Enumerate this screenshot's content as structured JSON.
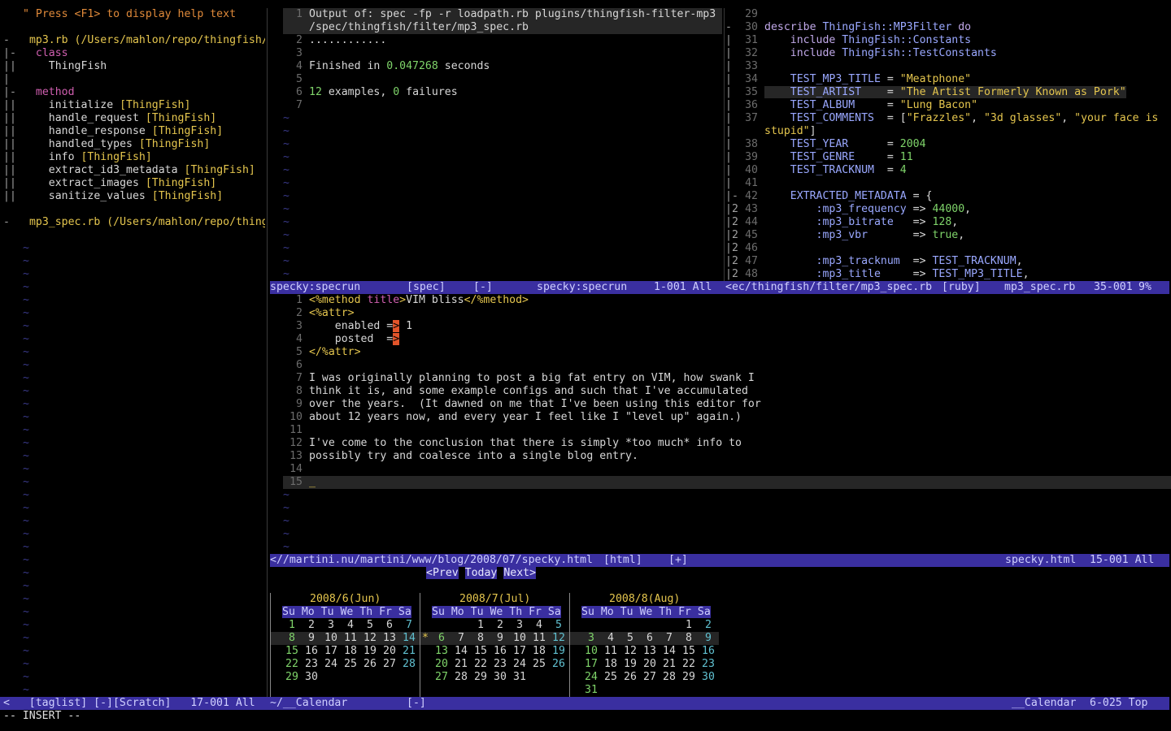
{
  "taglist": {
    "help": "\" Press <F1> to display help text",
    "lines": [
      {
        "fold": "",
        "text": ""
      },
      {
        "fold": "-",
        "text": " mp3.rb (/Users/mahlon/repo/thingfish/",
        "cls": "c-yel"
      },
      {
        "fold": "|-",
        "text": "  class",
        "cls": "c-mag"
      },
      {
        "fold": "||",
        "text": "    ThingFish",
        "cls": ""
      },
      {
        "fold": "|",
        "text": "",
        "cls": ""
      },
      {
        "fold": "|-",
        "text": "  method",
        "cls": "c-mag"
      },
      {
        "fold": "||",
        "text": "    initialize ",
        "cls": "",
        "tag": "[ThingFish]"
      },
      {
        "fold": "||",
        "text": "    handle_request ",
        "cls": "",
        "tag": "[ThingFish]"
      },
      {
        "fold": "||",
        "text": "    handle_response ",
        "cls": "",
        "tag": "[ThingFish]"
      },
      {
        "fold": "||",
        "text": "    handled_types ",
        "cls": "",
        "tag": "[ThingFish]"
      },
      {
        "fold": "||",
        "text": "    info ",
        "cls": "",
        "tag": "[ThingFish]"
      },
      {
        "fold": "||",
        "text": "    extract_id3_metadata ",
        "cls": "",
        "tag": "[ThingFish]"
      },
      {
        "fold": "||",
        "text": "    extract_images ",
        "cls": "",
        "tag": "[ThingFish]"
      },
      {
        "fold": "||",
        "text": "    sanitize_values ",
        "cls": "",
        "tag": "[ThingFish]"
      },
      {
        "fold": "",
        "text": "",
        "cls": ""
      },
      {
        "fold": "-",
        "text": " mp3_spec.rb (/Users/mahlon/repo/thing",
        "cls": "c-yel"
      },
      {
        "fold": "",
        "text": "",
        "cls": ""
      }
    ],
    "tilde": "~"
  },
  "specrun": {
    "lines": [
      {
        "n": "1",
        "text": "Output of: spec -fp -r loadpath.rb plugins/thingfish-filter-mp3",
        "hl": true
      },
      {
        "n": "",
        "text": "/spec/thingfish/filter/mp3_spec.rb",
        "hl": true
      },
      {
        "n": "2",
        "text": "............"
      },
      {
        "n": "3",
        "text": ""
      },
      {
        "n": "4",
        "text": "Finished in ",
        "num": "0.047268",
        "rest": " seconds"
      },
      {
        "n": "5",
        "text": ""
      },
      {
        "n": "6",
        "text": "",
        "num": "12",
        "rest": " examples, ",
        "num2": "0",
        "rest2": " failures"
      },
      {
        "n": "7",
        "text": ""
      }
    ],
    "status": {
      "left": "specky:specrun",
      "ft": "[spec]",
      "mod": "[-]",
      "name": "specky:specrun",
      "pos": "1-001 All"
    }
  },
  "spec_file": {
    "status": {
      "left": "<ec/thingfish/filter/mp3_spec.rb",
      "ft": "[ruby]",
      "name": "mp3_spec.rb",
      "pos": "35-001",
      "pct": "9%"
    },
    "lines": [
      {
        "f": "",
        "n": "29",
        "segs": []
      },
      {
        "f": "-",
        "n": "30",
        "segs": [
          [
            "c-kw",
            "describe "
          ],
          [
            "c-const",
            "ThingFish::MP3Filter "
          ],
          [
            "c-kw",
            "do"
          ]
        ]
      },
      {
        "f": "|",
        "n": "31",
        "segs": [
          [
            "",
            "    "
          ],
          [
            "c-kw",
            "include "
          ],
          [
            "c-const",
            "ThingFish::Constants"
          ]
        ]
      },
      {
        "f": "|",
        "n": "32",
        "segs": [
          [
            "",
            "    "
          ],
          [
            "c-kw",
            "include "
          ],
          [
            "c-const",
            "ThingFish::TestConstants"
          ]
        ]
      },
      {
        "f": "|",
        "n": "33",
        "segs": []
      },
      {
        "f": "|",
        "n": "34",
        "segs": [
          [
            "",
            "    "
          ],
          [
            "c-const",
            "TEST_MP3_TITLE "
          ],
          [
            "",
            "= "
          ],
          [
            "c-str",
            "\"Meatphone\""
          ]
        ]
      },
      {
        "f": "|",
        "n": "35",
        "hl": true,
        "segs": [
          [
            "",
            "    "
          ],
          [
            "c-const",
            "TEST_ARTIST    "
          ],
          [
            "",
            "= "
          ],
          [
            "c-str",
            "\"The Artist Formerly Known as Pork\""
          ]
        ]
      },
      {
        "f": "|",
        "n": "36",
        "segs": [
          [
            "",
            "    "
          ],
          [
            "c-const",
            "TEST_ALBUM     "
          ],
          [
            "",
            "= "
          ],
          [
            "c-str",
            "\"Lung Bacon\""
          ]
        ]
      },
      {
        "f": "|",
        "n": "37",
        "segs": [
          [
            "",
            "    "
          ],
          [
            "c-const",
            "TEST_COMMENTS  "
          ],
          [
            "",
            "= ["
          ],
          [
            "c-str",
            "\"Frazzles\""
          ],
          [
            "",
            ", "
          ],
          [
            "c-str",
            "\"3d glasses\""
          ],
          [
            "",
            ", "
          ],
          [
            "c-str",
            "\"your face is"
          ]
        ]
      },
      {
        "f": "|",
        "n": "",
        "segs": [
          [
            "c-str",
            "stupid\""
          ],
          [
            "",
            "]"
          ]
        ]
      },
      {
        "f": "|",
        "n": "38",
        "segs": [
          [
            "",
            "    "
          ],
          [
            "c-const",
            "TEST_YEAR      "
          ],
          [
            "",
            "= "
          ],
          [
            "c-num",
            "2004"
          ]
        ]
      },
      {
        "f": "|",
        "n": "39",
        "segs": [
          [
            "",
            "    "
          ],
          [
            "c-const",
            "TEST_GENRE     "
          ],
          [
            "",
            "= "
          ],
          [
            "c-num",
            "11"
          ]
        ]
      },
      {
        "f": "|",
        "n": "40",
        "segs": [
          [
            "",
            "    "
          ],
          [
            "c-const",
            "TEST_TRACKNUM  "
          ],
          [
            "",
            "= "
          ],
          [
            "c-num",
            "4"
          ]
        ]
      },
      {
        "f": "|",
        "n": "41",
        "segs": []
      },
      {
        "f": "|-",
        "n": "42",
        "segs": [
          [
            "",
            "    "
          ],
          [
            "c-const",
            "EXTRACTED_METADATA "
          ],
          [
            "",
            "= {"
          ]
        ]
      },
      {
        "f": "|2",
        "n": "43",
        "segs": [
          [
            "",
            "        "
          ],
          [
            "c-const",
            ":mp3_frequency "
          ],
          [
            "",
            "=> "
          ],
          [
            "c-num",
            "44000"
          ],
          [
            "",
            ","
          ]
        ]
      },
      {
        "f": "|2",
        "n": "44",
        "segs": [
          [
            "",
            "        "
          ],
          [
            "c-const",
            ":mp3_bitrate   "
          ],
          [
            "",
            "=> "
          ],
          [
            "c-num",
            "128"
          ],
          [
            "",
            ","
          ]
        ]
      },
      {
        "f": "|2",
        "n": "45",
        "segs": [
          [
            "",
            "        "
          ],
          [
            "c-const",
            ":mp3_vbr       "
          ],
          [
            "",
            "=> "
          ],
          [
            "c-num",
            "true"
          ],
          [
            "",
            ","
          ]
        ]
      },
      {
        "f": "|2",
        "n": "46",
        "segs": []
      },
      {
        "f": "|2",
        "n": "47",
        "segs": [
          [
            "",
            "        "
          ],
          [
            "c-const",
            ":mp3_tracknum  "
          ],
          [
            "",
            "=> "
          ],
          [
            "c-const",
            "TEST_TRACKNUM"
          ],
          [
            "",
            ","
          ]
        ]
      },
      {
        "f": "|2",
        "n": "48",
        "segs": [
          [
            "",
            "        "
          ],
          [
            "c-const",
            ":mp3_title     "
          ],
          [
            "",
            "=> "
          ],
          [
            "c-const",
            "TEST_MP3_TITLE"
          ],
          [
            "",
            ","
          ]
        ]
      }
    ]
  },
  "blog": {
    "lines": [
      {
        "n": "1",
        "segs": [
          [
            "c-str",
            "<%method "
          ],
          [
            "c-mag",
            "title"
          ],
          [
            "c-str",
            ">"
          ],
          [
            "",
            "VIM bliss"
          ],
          [
            "c-str",
            "</%method>"
          ]
        ]
      },
      {
        "n": "2",
        "segs": [
          [
            "c-str",
            "<%attr>"
          ]
        ]
      },
      {
        "n": "3",
        "segs": [
          [
            "",
            "    enabled ="
          ],
          [
            "cursor",
            ">"
          ],
          [
            "",
            " 1"
          ]
        ]
      },
      {
        "n": "4",
        "segs": [
          [
            "",
            "    posted  ="
          ],
          [
            "cursor",
            ">"
          ]
        ]
      },
      {
        "n": "5",
        "segs": [
          [
            "c-str",
            "</%attr>"
          ]
        ]
      },
      {
        "n": "6",
        "segs": []
      },
      {
        "n": "7",
        "segs": [
          [
            "",
            "I was originally planning to post a big fat entry on VIM, how swank I"
          ]
        ]
      },
      {
        "n": "8",
        "segs": [
          [
            "",
            "think it is, and some example configs and such that I've accumulated"
          ]
        ]
      },
      {
        "n": "9",
        "segs": [
          [
            "",
            "over the years.  (It dawned on me that I've been using this editor for"
          ]
        ]
      },
      {
        "n": "10",
        "segs": [
          [
            "",
            "about 12 years now, and every year I feel like I \"level up\" again.)"
          ]
        ]
      },
      {
        "n": "11",
        "segs": []
      },
      {
        "n": "12",
        "segs": [
          [
            "",
            "I've come to the conclusion that there is simply *too much* info to"
          ]
        ]
      },
      {
        "n": "13",
        "segs": [
          [
            "",
            "possibly try and coalesce into a single blog entry."
          ]
        ]
      },
      {
        "n": "14",
        "segs": []
      },
      {
        "n": "15",
        "hl": true,
        "segs": [
          [
            "c-yel",
            "_"
          ]
        ]
      }
    ],
    "status": {
      "left": "<//martini.nu/martini/www/blog/2008/07/specky.html",
      "ft": "[html]",
      "mod": "[+]",
      "name": "specky.html",
      "pos": "15-001 All"
    }
  },
  "calendar": {
    "nav": {
      "prev": "<Prev",
      "today": "Today",
      "next": "Next>"
    },
    "months": [
      {
        "title": "2008/6(Jun)",
        "rows": [
          [
            "1",
            "2",
            "3",
            "4",
            "5",
            "6",
            "7"
          ],
          [
            "8",
            "9",
            "10",
            "11",
            "12",
            "13",
            "14"
          ],
          [
            "15",
            "16",
            "17",
            "18",
            "19",
            "20",
            "21"
          ],
          [
            "22",
            "23",
            "24",
            "25",
            "26",
            "27",
            "28"
          ],
          [
            "29",
            "30",
            "",
            "",
            "",
            "",
            ""
          ],
          [
            "",
            "",
            "",
            "",
            "",
            "",
            ""
          ]
        ]
      },
      {
        "title": "2008/7(Jul)",
        "rows": [
          [
            "",
            "",
            "1",
            "2",
            "3",
            "4",
            "5"
          ],
          [
            "6",
            "7",
            "8",
            "9",
            "10",
            "11",
            "12"
          ],
          [
            "13",
            "14",
            "15",
            "16",
            "17",
            "18",
            "19"
          ],
          [
            "20",
            "21",
            "22",
            "23",
            "24",
            "25",
            "26"
          ],
          [
            "27",
            "28",
            "29",
            "30",
            "31",
            "",
            ""
          ],
          [
            "",
            "",
            "",
            "",
            "",
            "",
            ""
          ]
        ]
      },
      {
        "title": "2008/8(Aug)",
        "rows": [
          [
            "",
            "",
            "",
            "",
            "",
            "1",
            "2"
          ],
          [
            "3",
            "4",
            "5",
            "6",
            "7",
            "8",
            "9"
          ],
          [
            "10",
            "11",
            "12",
            "13",
            "14",
            "15",
            "16"
          ],
          [
            "17",
            "18",
            "19",
            "20",
            "21",
            "22",
            "23"
          ],
          [
            "24",
            "25",
            "26",
            "27",
            "28",
            "29",
            "30"
          ],
          [
            "31",
            "",
            "",
            "",
            "",
            "",
            ""
          ]
        ]
      }
    ],
    "weekdays": "Su Mo Tu We Th Fr Sa",
    "today_marker": "*",
    "status": {
      "left": "~/__Calendar",
      "mod": "[-]",
      "name": "__Calendar",
      "pos": "6-025 Top"
    }
  },
  "taglist_status": {
    "left": "<   [taglist] [-][Scratch]   17-001 All"
  },
  "cmdline": "-- INSERT --"
}
